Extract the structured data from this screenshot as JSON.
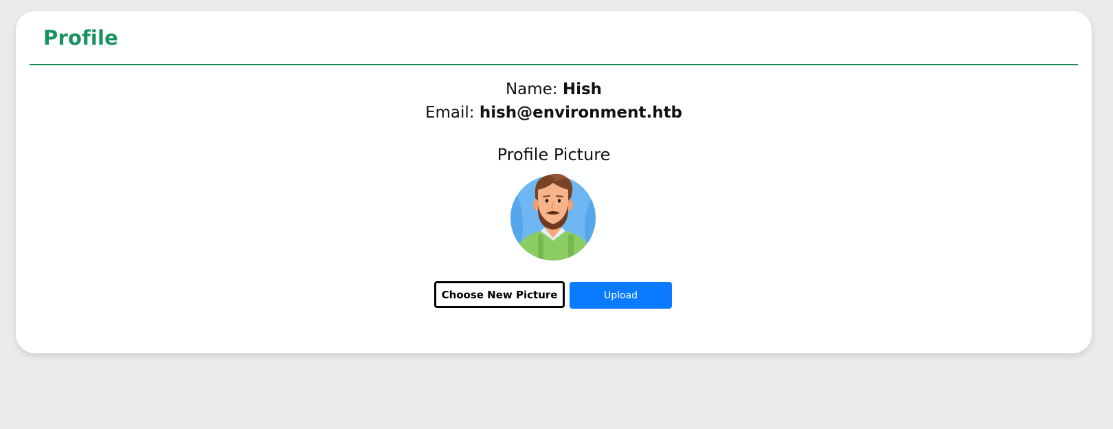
{
  "card": {
    "title": "Profile"
  },
  "profile": {
    "name_label": "Name:",
    "name_value": "Hish",
    "email_label": "Email:",
    "email_value": "hish@environment.htb"
  },
  "picture": {
    "heading": "Profile Picture",
    "avatar_icon": "bearded-man-avatar-icon"
  },
  "actions": {
    "choose_label": "Choose New Picture",
    "upload_label": "Upload"
  },
  "colors": {
    "accent_green": "#17935c",
    "upload_blue": "#0a7bff",
    "page_background": "#ebebeb"
  }
}
